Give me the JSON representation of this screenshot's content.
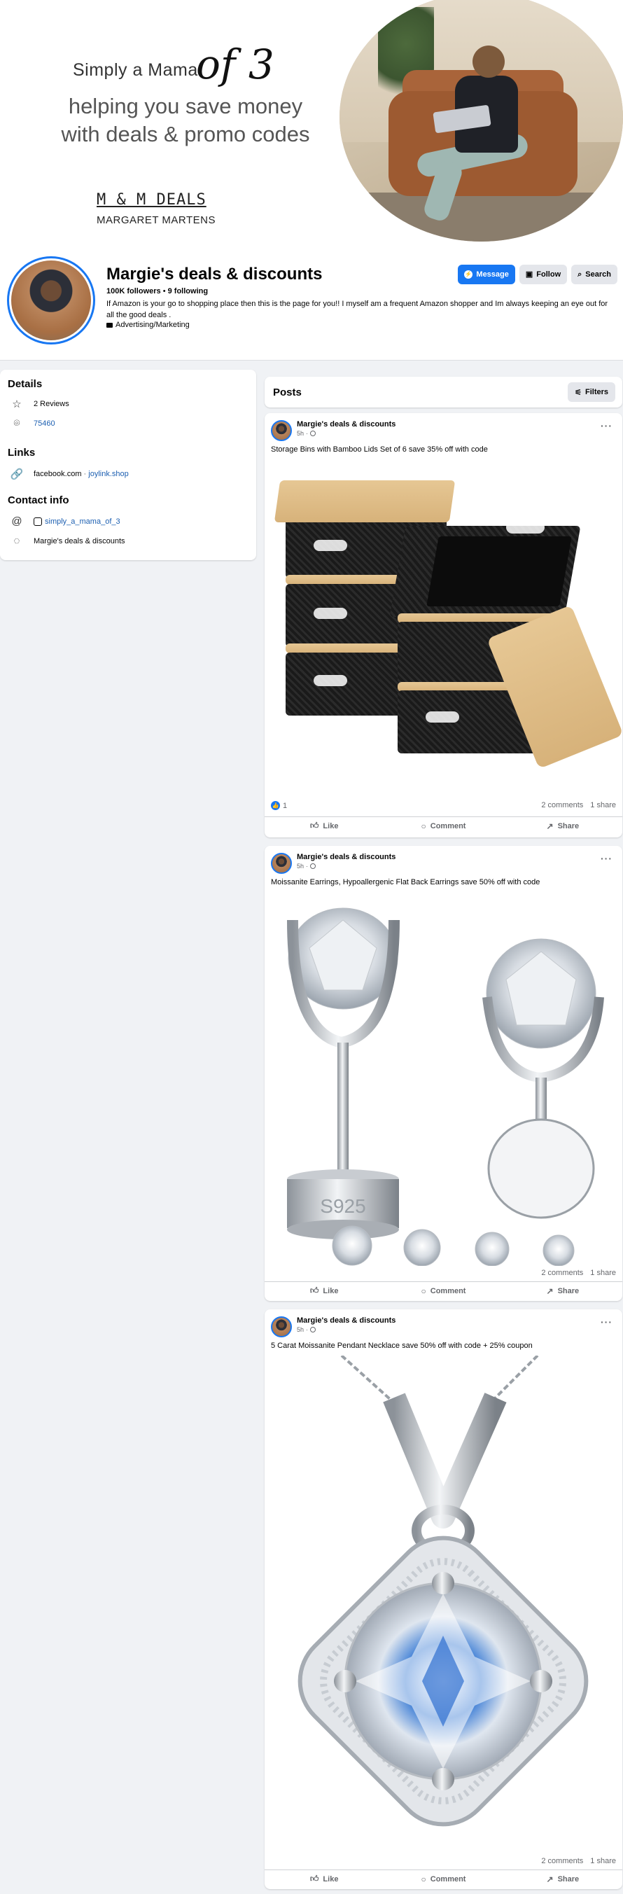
{
  "cover": {
    "line1": "Simply a Mama",
    "line1_big": "of 3",
    "line2a": "helping you save money",
    "line2b": "with deals & promo codes",
    "brand": "M & M DEALS",
    "brand_sub": "MARGARET MARTENS"
  },
  "profile": {
    "name": "Margie's deals & discounts",
    "followers": "100K followers",
    "following": "9 following",
    "bio": "If Amazon is your go to shopping place then this is the page for you!! I myself am a frequent Amazon shopper and Im always keeping an eye out for all the good deals .",
    "category": "Advertising/Marketing",
    "buttons": {
      "message": "Message",
      "follow": "Follow",
      "search": "Search"
    }
  },
  "intro": {
    "details_title": "Details",
    "reviews": "2 Reviews",
    "zip": "75460",
    "links_title": "Links",
    "link_domain": "facebook.com",
    "link_site": "joylink.shop",
    "contact_title": "Contact info",
    "instagram": "simply_a_mama_of_3",
    "messenger": "Margie's deals & discounts"
  },
  "posts_header": {
    "title": "Posts",
    "filters": "Filters"
  },
  "posts": [
    {
      "author": "Margie's deals & discounts",
      "time": "5h",
      "text": "Storage Bins with Bamboo Lids Set of 6  save 35% off with code",
      "likes": "1",
      "comments": "2 comments",
      "shares": "1 share"
    },
    {
      "author": "Margie's deals & discounts",
      "time": "5h",
      "text": "Moissanite Earrings, Hypoallergenic Flat Back Earrings save 50% off with code",
      "comments": "2 comments",
      "shares": "1 share",
      "engraving": "S925"
    },
    {
      "author": "Margie's deals & discounts",
      "time": "5h",
      "text": "5 Carat Moissanite Pendant Necklace  save 50% off with code + 25% coupon",
      "comments": "2 comments",
      "shares": "1 share"
    }
  ],
  "actions": {
    "like": "Like",
    "comment": "Comment",
    "share": "Share"
  },
  "colors": {
    "accent": "#1877f2",
    "page_bg": "#f0f2f5",
    "link": "#1c5fb1"
  },
  "icons": [
    "messenger-icon",
    "follow-icon",
    "search-icon",
    "star-icon",
    "location-icon",
    "link-icon",
    "at-icon",
    "instagram-icon",
    "chat-icon",
    "filters-icon",
    "more-icon",
    "globe-icon",
    "like-icon",
    "comment-icon",
    "share-icon"
  ]
}
